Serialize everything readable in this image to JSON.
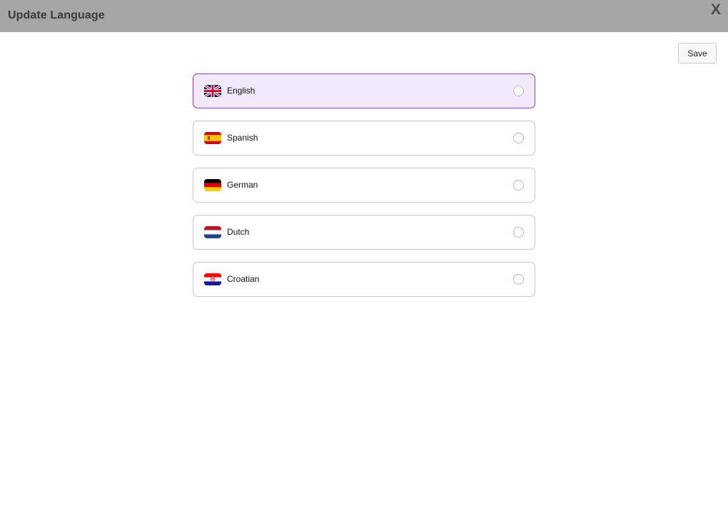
{
  "header": {
    "title": "Update Language",
    "close_label": "X"
  },
  "toolbar": {
    "save_label": "Save"
  },
  "languages": [
    {
      "label": "English",
      "flag": "uk-flag-icon",
      "selected": true
    },
    {
      "label": "Spanish",
      "flag": "spain-flag-icon",
      "selected": false
    },
    {
      "label": "German",
      "flag": "germany-flag-icon",
      "selected": false
    },
    {
      "label": "Dutch",
      "flag": "netherlands-flag-icon",
      "selected": false
    },
    {
      "label": "Croatian",
      "flag": "croatia-flag-icon",
      "selected": false
    }
  ],
  "colors": {
    "header_bg": "#a6a6a6",
    "selected_bg": "#f2e9fd",
    "selected_border": "#8a3fc2"
  }
}
